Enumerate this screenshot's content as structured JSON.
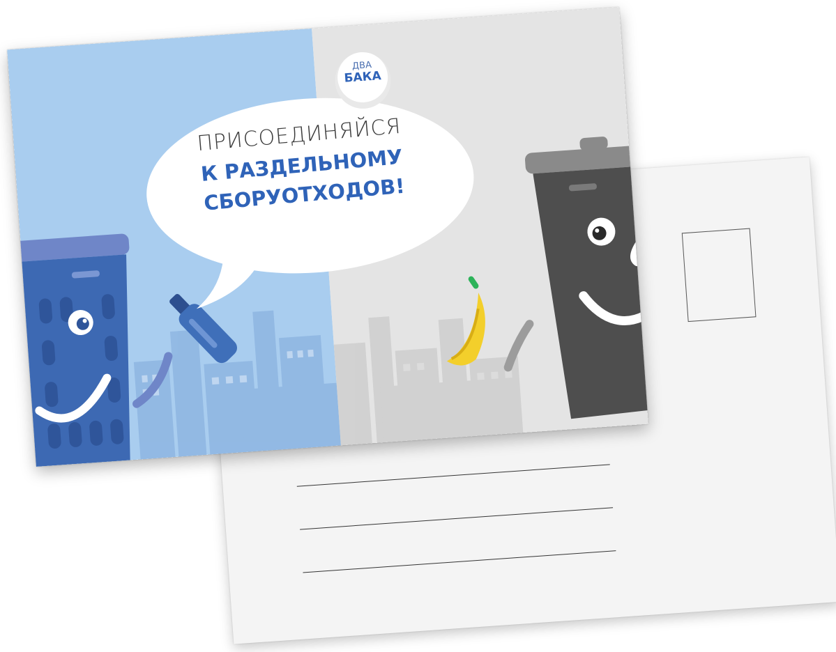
{
  "logo": {
    "line1": "ДВА",
    "line2": "БАКА"
  },
  "headline": {
    "line1": "ПРИСОЕДИНЯЙСЯ",
    "line2": "К РАЗДЕЛЬНОМУ",
    "line3": "СБОРУОТХОДОВ!"
  },
  "colors": {
    "left_panel": "#a9cdef",
    "right_panel": "#e4e4e4",
    "blue_bin": "#3d69b3",
    "gray_bin": "#4e4e4e",
    "headline_accent": "#2f63b8",
    "banana": "#f3cf2b",
    "banana_stem": "#2db35a",
    "bottle": "#3f6fb9"
  },
  "icons": {
    "blue_bin": "smiling-blue-trash-bin-icon",
    "gray_bin": "smiling-gray-trash-bin-icon",
    "bottle": "glass-bottle-icon",
    "banana": "banana-peel-icon",
    "city": "city-skyline-icon"
  }
}
